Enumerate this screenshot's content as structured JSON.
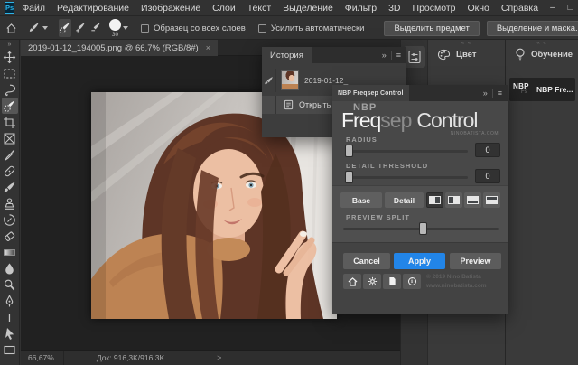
{
  "window": {
    "app_logo": "Ps",
    "controls": {
      "minimize": "–",
      "maximize": "□",
      "close": "×"
    }
  },
  "menubar": {
    "items": [
      "Файл",
      "Редактирование",
      "Изображение",
      "Слои",
      "Текст",
      "Выделение",
      "Фильтр",
      "3D",
      "Просмотр",
      "Окно",
      "Справка"
    ]
  },
  "options_bar": {
    "brush_size": "30",
    "sample_all_layers_label": "Образец со всех слоев",
    "auto_enhance_label": "Усилить автоматически",
    "select_subject_label": "Выделить предмет",
    "select_and_mask_label": "Выделение и маска..."
  },
  "toolbar": {
    "expand_icon": "»",
    "tools": [
      "move",
      "rectangular-marquee",
      "lasso",
      "quick-selection",
      "crop",
      "frame",
      "eyedropper",
      "spot-healing",
      "brush",
      "clone-stamp",
      "history-brush",
      "eraser",
      "gradient",
      "blur",
      "dodge",
      "pen",
      "type",
      "path-selection",
      "rectangle"
    ],
    "active_tool": "quick-selection"
  },
  "document": {
    "tab_title": "2019-01-12_194005.png @ 66,7% (RGB/8#)",
    "tab_close": "×"
  },
  "status_bar": {
    "zoom": "66,67%",
    "doc_info": "Док: 916,3K/916,3K",
    "chevron": ">"
  },
  "history_panel": {
    "tab": "История",
    "collapse_icon": "»",
    "menu_icon": "≡",
    "snapshot_label": "2019-01-12_",
    "open_row_label": "Открыть"
  },
  "nbp_panel": {
    "tab": "NBP Freqsep Control",
    "collapse_icon": "»",
    "menu_icon": "≡",
    "logo_top": "NBP",
    "logo_freq": "Freq",
    "logo_sep": "sep",
    "logo_control": "Control",
    "logo_site": "NINOBATISTA.COM",
    "radius_label": "RADIUS",
    "radius_value": "0",
    "detail_threshold_label": "DETAIL THRESHOLD",
    "detail_threshold_value": "0",
    "base_label": "Base",
    "detail_label": "Detail",
    "preview_split_label": "PREVIEW SPLIT",
    "cancel_label": "Cancel",
    "apply_label": "Apply",
    "preview_label": "Preview",
    "apply_color": "#2285e8",
    "info_glyph": "i",
    "copyright_line1": "© 2019 Nino Batista",
    "copyright_line2": "www.ninobatista.com"
  },
  "right_docks": {
    "grip_icon": "« «",
    "color_tab": "Цвет",
    "learn_tab": "Обучение",
    "nbp_collapsed_label": "NBP Fre...",
    "nbp_logo_main": "NBP",
    "nbp_logo_sub": "Fs"
  }
}
